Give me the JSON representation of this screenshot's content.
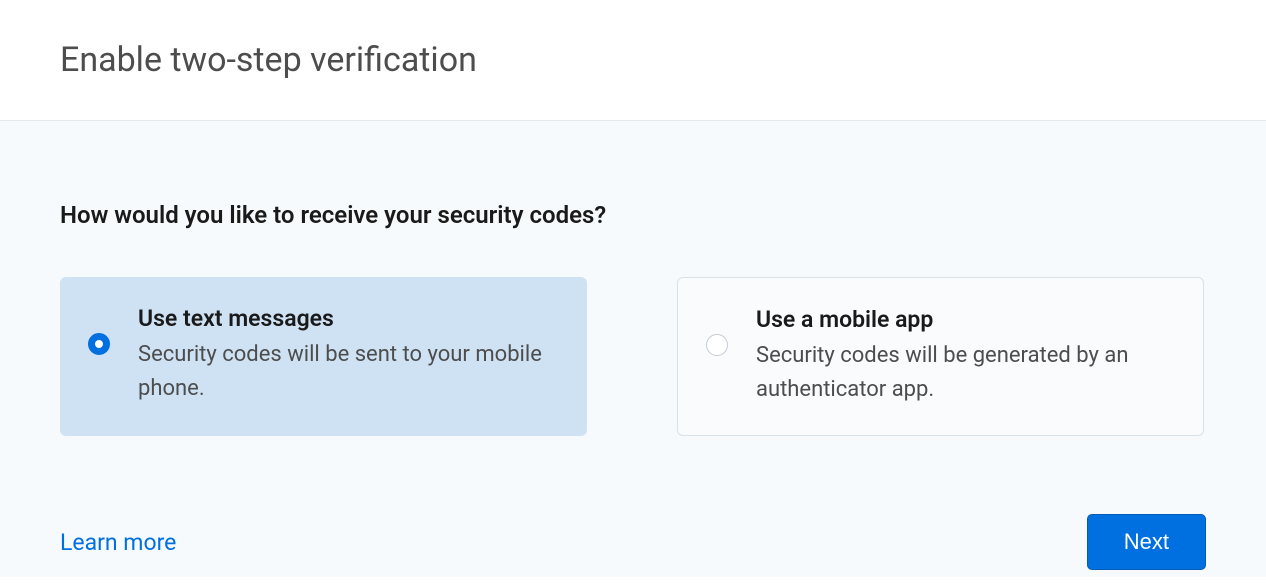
{
  "header": {
    "title": "Enable two-step verification"
  },
  "content": {
    "question": "How would you like to receive your security codes?",
    "options": [
      {
        "title": "Use text messages",
        "description": "Security codes will be sent to your mobile phone.",
        "selected": true
      },
      {
        "title": "Use a mobile app",
        "description": "Security codes will be generated by an authenticator app.",
        "selected": false
      }
    ]
  },
  "footer": {
    "learn_more": "Learn more",
    "next": "Next"
  }
}
